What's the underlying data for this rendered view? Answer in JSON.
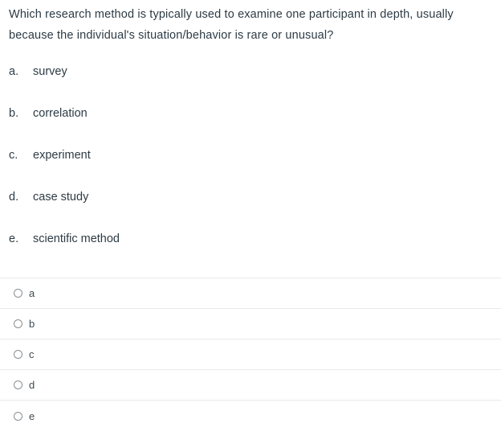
{
  "question": {
    "stem": "Which research method is typically used to examine one participant in depth, usually because the individual's situation/behavior is rare or unusual?",
    "choices": [
      {
        "letter": "a.",
        "text": "survey"
      },
      {
        "letter": "b.",
        "text": "correlation"
      },
      {
        "letter": "c.",
        "text": "experiment"
      },
      {
        "letter": "d.",
        "text": "case study"
      },
      {
        "letter": "e.",
        "text": "scientific method"
      }
    ]
  },
  "answers": {
    "options": [
      {
        "id": "a",
        "label": "a",
        "selected": false
      },
      {
        "id": "b",
        "label": "b",
        "selected": false
      },
      {
        "id": "c",
        "label": "c",
        "selected": false
      },
      {
        "id": "d",
        "label": "d",
        "selected": false
      },
      {
        "id": "e",
        "label": "e",
        "selected": false
      }
    ]
  },
  "colors": {
    "text": "#2d3b45",
    "divider": "#e8eaec",
    "radio_border": "#8b8f93",
    "background": "#ffffff"
  }
}
